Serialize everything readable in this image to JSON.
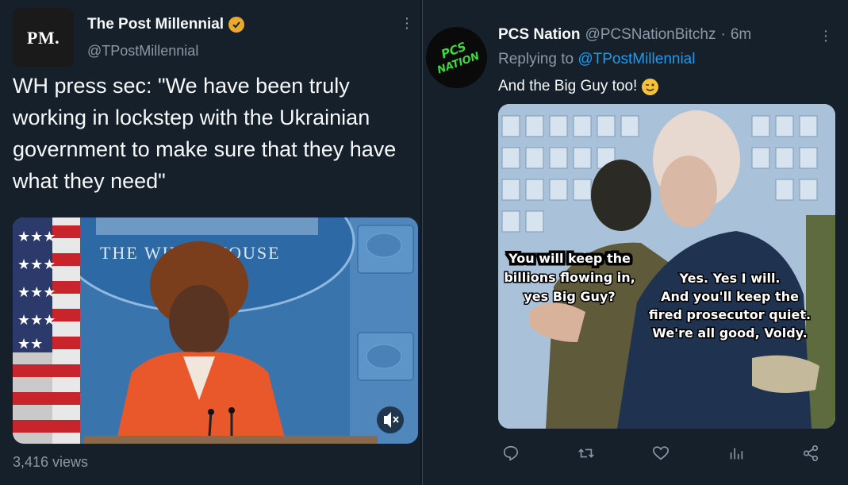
{
  "left_tweet": {
    "avatar_text": "PM.",
    "name": "The Post Millennial",
    "handle": "@TPostMillennial",
    "text": "WH press sec: \"We have been truly working in lockstep with the Ukrainian government to make sure that they have what they need\"",
    "media": {
      "seal_text": "THE WHITE HOUSE",
      "mute_icon": "mute-icon"
    },
    "views": "3,416 views"
  },
  "right_tweet": {
    "avatar_text_line1": "PCS",
    "avatar_text_line2": "NATION",
    "name": "PCS Nation",
    "handle": "@PCSNationBitchz",
    "separator": "·",
    "time": "6m",
    "replying_label": "Replying to",
    "replying_to": "@TPostMillennial",
    "text": "And the Big Guy too!",
    "emoji": "winking-face",
    "meme": {
      "left_caption": [
        "You will keep the",
        "billions flowing in,",
        "yes Big Guy?"
      ],
      "right_caption": [
        "Yes. Yes I will.",
        "And you'll keep the",
        "fired prosecutor quiet.",
        "We're all good, Voldy."
      ]
    },
    "actions": [
      "reply-icon",
      "retweet-icon",
      "like-icon",
      "analytics-icon",
      "share-icon"
    ]
  },
  "colors": {
    "background": "#15202b",
    "text_primary": "#f7f9f9",
    "text_secondary": "#8b98a5",
    "link": "#1d9bf0",
    "verified_badge": "#e8a92c"
  }
}
